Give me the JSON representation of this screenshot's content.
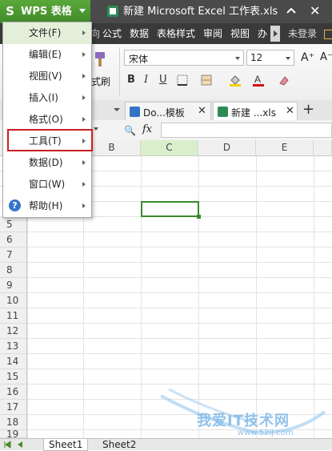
{
  "app": {
    "name": "WPS 表格",
    "logo_letter": "S",
    "window_title": "新建 Microsoft Excel 工作表.xls",
    "login": "未登录"
  },
  "ribbon_tabs": [
    "公式",
    "数据",
    "表格样式",
    "审阅",
    "视图",
    "办"
  ],
  "toolbar": {
    "format_brush": "式刷",
    "font_name": "宋体",
    "font_size": "12",
    "bold": "B",
    "italic": "I",
    "underline": "U",
    "grow_font": "A⁺",
    "shrink_font": "A⁻"
  },
  "doc_tabs": [
    {
      "label": "Do...模板",
      "icon_color": "#3574c4"
    },
    {
      "label": "新建 ...xls",
      "icon_color": "#2e8b57"
    }
  ],
  "formula_bar": {
    "zoom_icon": "🔍",
    "fx": "fx",
    "content": ""
  },
  "columns": [
    "B",
    "C",
    "D",
    "E"
  ],
  "rows": [
    "5",
    "6",
    "7",
    "8",
    "9",
    "10",
    "11",
    "12",
    "13",
    "14",
    "15",
    "16",
    "17",
    "18",
    "19"
  ],
  "menu": {
    "items": [
      {
        "label": "文件(F)"
      },
      {
        "label": "编辑(E)"
      },
      {
        "label": "视图(V)"
      },
      {
        "label": "插入(I)"
      },
      {
        "label": "格式(O)"
      },
      {
        "label": "工具(T)"
      },
      {
        "label": "数据(D)"
      },
      {
        "label": "窗口(W)"
      },
      {
        "label": "帮助(H)"
      }
    ],
    "help_icon": "?"
  },
  "sheets": [
    "Sheet1",
    "Sheet2"
  ],
  "watermark": {
    "text": "我爱IT技术网",
    "url": "www.52ij.com"
  },
  "colors": {
    "accent": "#3f8a28",
    "highlight": "#c81e1e",
    "title_bar": "#4a4a4a",
    "selected_col": "#dbeecb"
  }
}
